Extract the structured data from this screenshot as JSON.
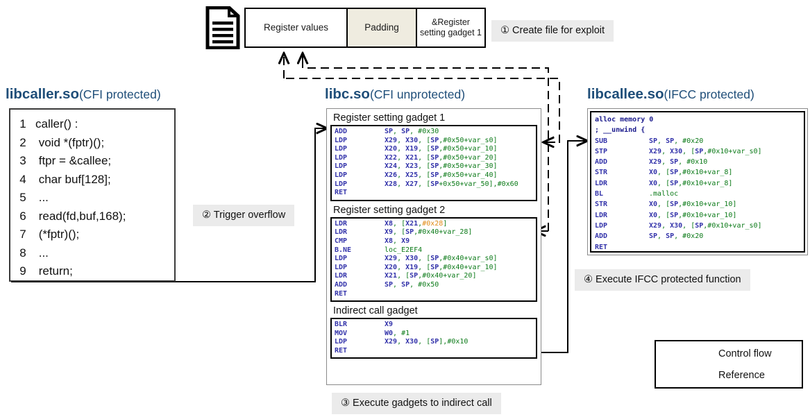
{
  "file": {
    "icon": "document-icon",
    "cells": [
      {
        "label": "Register values",
        "kind": "regvals"
      },
      {
        "label": "Padding",
        "kind": "padding"
      },
      {
        "label": "&Register setting gadget 1",
        "kind": "gadget"
      }
    ]
  },
  "steps": [
    {
      "num": "①",
      "label": "Create file for exploit"
    },
    {
      "num": "②",
      "label": "Trigger overflow"
    },
    {
      "num": "③",
      "label": "Execute gadgets to indirect call"
    },
    {
      "num": "④",
      "label": "Execute IFCC protected function"
    }
  ],
  "libcaller": {
    "title_bold": "libcaller.so",
    "title_rest": "(CFI protected)",
    "lines": [
      {
        "no": "1",
        "code": "caller() :"
      },
      {
        "no": "2",
        "code": " void *(fptr)();"
      },
      {
        "no": "3",
        "code": " ftpr = &callee;"
      },
      {
        "no": "4",
        "code": " char buf[128];"
      },
      {
        "no": "5",
        "code": " ..."
      },
      {
        "no": "6",
        "code": " read(fd,buf,168);"
      },
      {
        "no": "7",
        "code": " (*fptr)();"
      },
      {
        "no": "8",
        "code": " ..."
      },
      {
        "no": "9",
        "code": " return;"
      }
    ]
  },
  "libc": {
    "title_bold": "libc.so",
    "title_rest": "(CFI unprotected)",
    "gadgets": [
      {
        "label": "Register setting gadget 1",
        "rows": [
          {
            "mn": "ADD",
            "op": "SP, SP, #0x30"
          },
          {
            "mn": "LDP",
            "op": "X29, X30, [SP,#0x50+var_s0]"
          },
          {
            "mn": "LDP",
            "op": "X20, X19, [SP,#0x50+var_10]"
          },
          {
            "mn": "LDP",
            "op": "X22, X21, [SP,#0x50+var_20]"
          },
          {
            "mn": "LDP",
            "op": "X24, X23, [SP,#0x50+var_30]"
          },
          {
            "mn": "LDP",
            "op": "X26, X25, [SP,#0x50+var_40]"
          },
          {
            "mn": "LDP",
            "op": "X28, X27, [SP+0x50+var_50],#0x60"
          },
          {
            "mn": "RET",
            "op": ""
          }
        ]
      },
      {
        "label": "Register setting gadget 2",
        "rows": [
          {
            "mn": "LDR",
            "op": "X8, [X21,#0x28]",
            "hl": "#0x28"
          },
          {
            "mn": "LDR",
            "op": "X9, [SP,#0x40+var_28]"
          },
          {
            "mn": "CMP",
            "op": "X8, X9"
          },
          {
            "mn": "B.NE",
            "op": "loc_E2EF4"
          },
          {
            "mn": "LDP",
            "op": "X29, X30, [SP,#0x40+var_s0]"
          },
          {
            "mn": "LDP",
            "op": "X20, X19, [SP,#0x40+var_10]"
          },
          {
            "mn": "LDR",
            "op": "X21, [SP,#0x40+var_20]"
          },
          {
            "mn": "ADD",
            "op": "SP, SP, #0x50"
          },
          {
            "mn": "RET",
            "op": ""
          }
        ]
      },
      {
        "label": "Indirect call gadget",
        "rows": [
          {
            "mn": "BLR",
            "op": "X9"
          },
          {
            "mn": "MOV",
            "op": "W0, #1"
          },
          {
            "mn": "LDP",
            "op": "X29, X30, [SP],#0x10"
          },
          {
            "mn": "RET",
            "op": ""
          }
        ]
      }
    ]
  },
  "libcallee": {
    "title_bold": "libcallee.so",
    "title_rest": "(IFCC protected)",
    "comments": [
      "alloc memory 0",
      "; __unwind {"
    ],
    "rows": [
      {
        "mn": "SUB",
        "op": "SP, SP, #0x20"
      },
      {
        "mn": "STP",
        "op": "X29, X30, [SP,#0x10+var_s0]"
      },
      {
        "mn": "ADD",
        "op": "X29, SP, #0x10"
      },
      {
        "mn": "STR",
        "op": "X0, [SP,#0x10+var_8]"
      },
      {
        "mn": "LDR",
        "op": "X0, [SP,#0x10+var_8]"
      },
      {
        "mn": "BL",
        "op": ".malloc"
      },
      {
        "mn": "STR",
        "op": "X0, [SP,#0x10+var_10]"
      },
      {
        "mn": "LDR",
        "op": "X0, [SP,#0x10+var_10]"
      },
      {
        "mn": "LDP",
        "op": "X29, X30, [SP,#0x10+var_s0]"
      },
      {
        "mn": "ADD",
        "op": "SP, SP, #0x20"
      },
      {
        "mn": "RET",
        "op": ""
      }
    ]
  },
  "legend": [
    {
      "style": "solid",
      "label": "Control flow"
    },
    {
      "style": "dashed",
      "label": "Reference"
    }
  ],
  "colors": {
    "title": "#1F4E79",
    "mnemonic": "#3333AA",
    "operand": "#0B7A18",
    "highlight": "#E08A14",
    "padding_fill": "#EFECE0",
    "chip_bg": "#EBEBEB"
  }
}
